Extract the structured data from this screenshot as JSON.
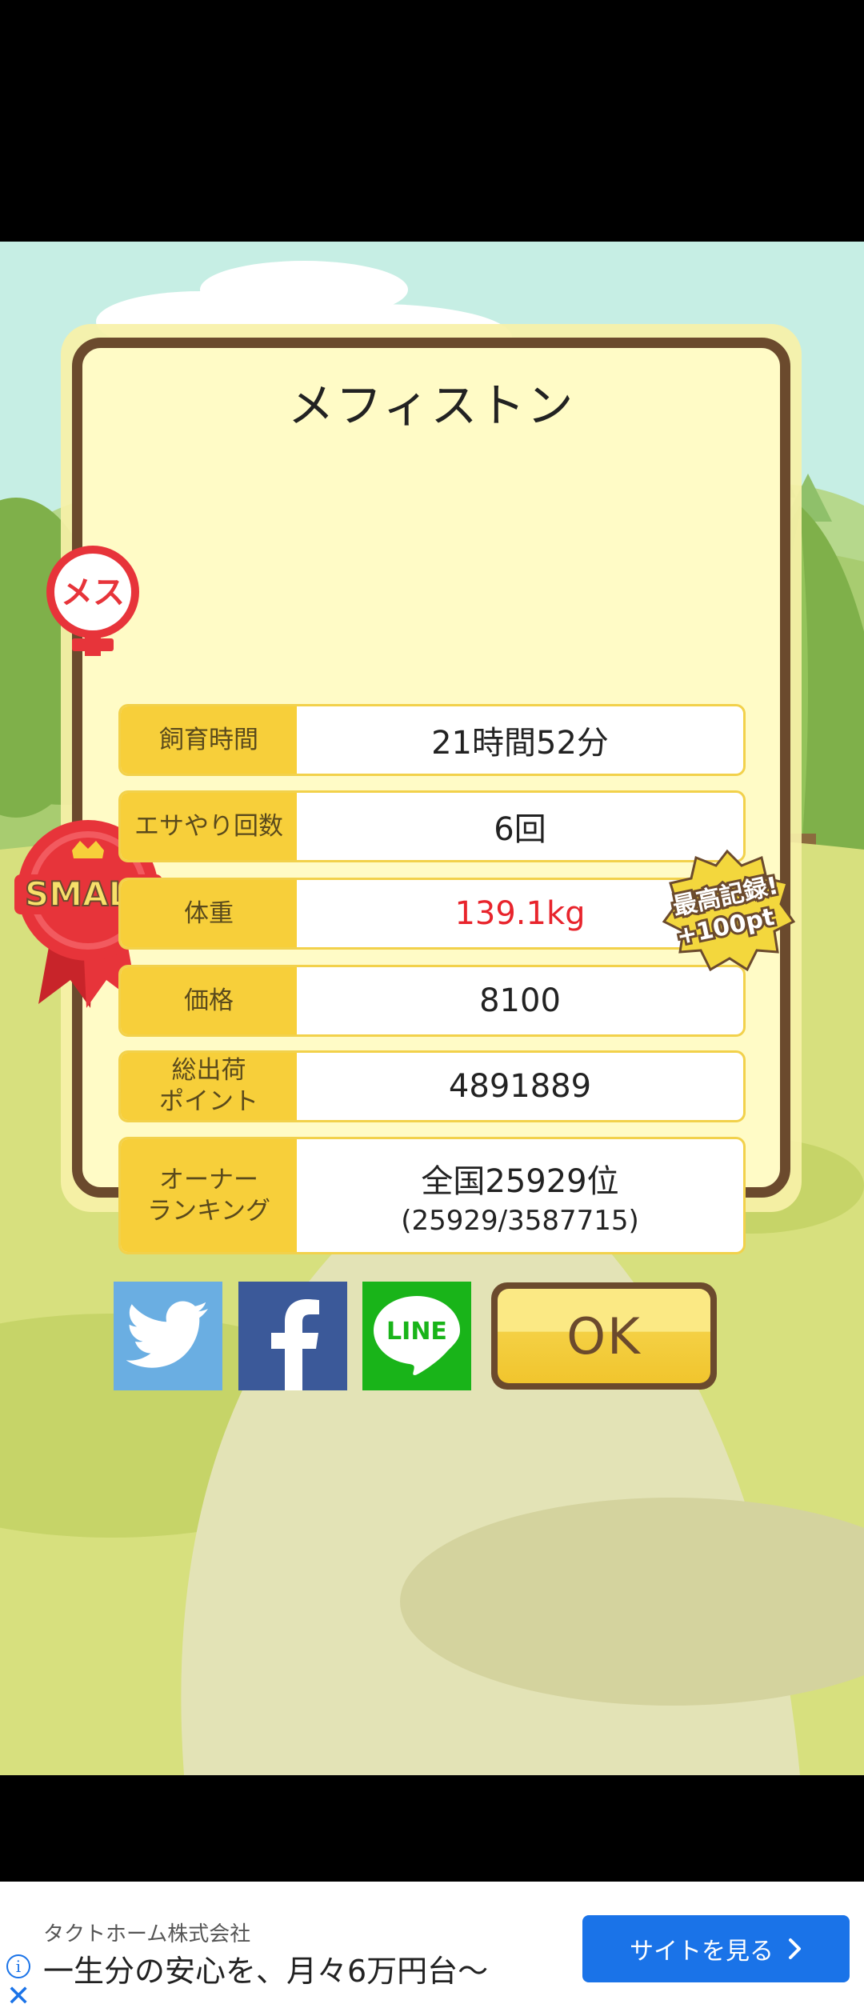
{
  "monster": {
    "name": "メフィストン",
    "gender_badge": "メス",
    "size_badge": "SMALL",
    "record_badge_line1": "最高記録!",
    "record_badge_line2": "+100pt"
  },
  "stats": [
    {
      "label": "飼育時間",
      "value": "21時間52分"
    },
    {
      "label": "エサやり回数",
      "value": "6回"
    },
    {
      "label": "体重",
      "value": "139.1kg",
      "highlight_color": "#e8242c"
    },
    {
      "label": "価格",
      "value": "8100"
    },
    {
      "label_line1": "総出荷",
      "label_line2": "ポイント",
      "value": "4891889"
    },
    {
      "label_line1": "オーナー",
      "label_line2": "ランキング",
      "value": "全国25929位",
      "value_sub": "(25929/3587715)"
    }
  ],
  "share": {
    "twitter_icon": "twitter-bird-icon",
    "facebook_icon": "facebook-f-icon",
    "line_label": "LINE"
  },
  "ok_label": "OK",
  "ad": {
    "company": "タクトホーム株式会社",
    "copy": "一生分の安心を、月々6万円台〜",
    "cta": "サイトを見る",
    "cta_icon": "chevron-right-icon",
    "info_icon": "info-icon",
    "close_icon": "close-icon"
  },
  "colors": {
    "panel_border": "#6b4a2d",
    "label_bg": "#f7cf3a",
    "accent_red": "#e8242c",
    "twitter": "#6aaee2",
    "facebook": "#3b5999",
    "line": "#19b419",
    "ad_button": "#1a73e8"
  }
}
